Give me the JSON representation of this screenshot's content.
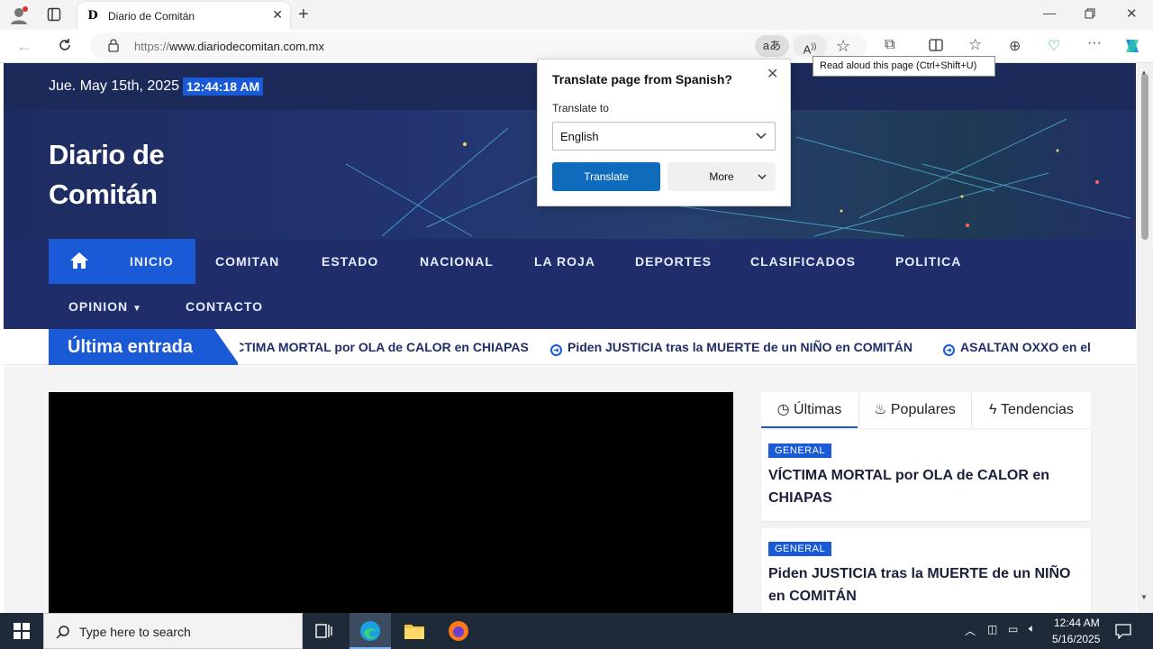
{
  "browser": {
    "tab_title": "Diario de Comitán",
    "tab_favicon": "D",
    "url_prefix": "https://",
    "url_host": "www.diariodecomitan.com.mx",
    "tooltip": "Read aloud this page (Ctrl+Shift+U)"
  },
  "site": {
    "date": "Jue. May 15th, 2025",
    "time": "12:44:18 AM",
    "logo_line1": "Diario de",
    "logo_line2": "Comitán",
    "nav": [
      "INICIO",
      "COMITAN",
      "ESTADO",
      "NACIONAL",
      "LA ROJA",
      "DEPORTES",
      "CLASIFICADOS",
      "POLITICA"
    ],
    "nav_row2": [
      "OPINION",
      "CONTACTO"
    ],
    "ticker_label": "Última entrada",
    "ticker": [
      "VÍCTIMA MORTAL por OLA de CALOR en CHIAPAS",
      "Piden JUSTICIA tras la MUERTE de un NIÑO en COMITÁN",
      "ASALTAN OXXO en el"
    ],
    "side_tabs": [
      "Últimas",
      "Populares",
      "Tendencias"
    ],
    "cards": [
      {
        "badge": "GENERAL",
        "title": "VÍCTIMA MORTAL por OLA de CALOR en CHIAPAS"
      },
      {
        "badge": "GENERAL",
        "title": "Piden JUSTICIA tras la MUERTE de un NIÑO en COMITÁN"
      }
    ]
  },
  "translate": {
    "title": "Translate page from Spanish?",
    "to_label": "Translate to",
    "language": "English",
    "translate_btn": "Translate",
    "more_btn": "More"
  },
  "taskbar": {
    "search_placeholder": "Type here to search",
    "clock_time": "12:44 AM",
    "clock_date": "5/16/2025"
  },
  "colors": {
    "accent": "#1a5ad6",
    "nav_bg": "#1f2d6b",
    "topbar_bg": "#1c2a5a",
    "edge_blue": "#0f6cbd"
  }
}
